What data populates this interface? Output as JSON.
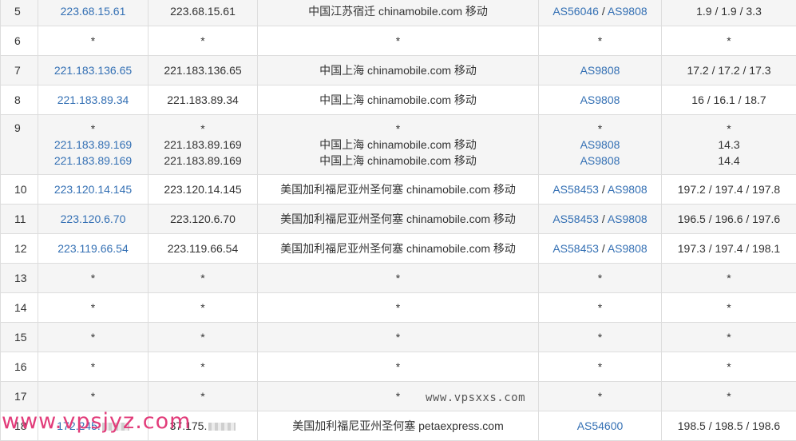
{
  "rows": [
    {
      "hop": "5",
      "ip": "223.68.15.61",
      "host": "223.68.15.61",
      "loc": "中国江苏宿迁 chinamobile.com 移动",
      "asn": [
        "AS56046",
        "AS9808"
      ],
      "time": "1.9 / 1.9 / 3.3"
    },
    {
      "hop": "6",
      "ip": "*",
      "host": "*",
      "loc": "*",
      "asn": [
        "*"
      ],
      "time": "*"
    },
    {
      "hop": "7",
      "ip": "221.183.136.65",
      "host": "221.183.136.65",
      "loc": "中国上海 chinamobile.com 移动",
      "asn": [
        "AS9808"
      ],
      "time": "17.2 / 17.2 / 17.3"
    },
    {
      "hop": "8",
      "ip": "221.183.89.34",
      "host": "221.183.89.34",
      "loc": "中国上海 chinamobile.com 移动",
      "asn": [
        "AS9808"
      ],
      "time": "16 / 16.1 / 18.7"
    },
    {
      "hop": "9",
      "multi": [
        {
          "ip": "*",
          "host": "*",
          "loc": "*",
          "asn": [
            "*"
          ],
          "time": "*"
        },
        {
          "ip": "221.183.89.169",
          "host": "221.183.89.169",
          "loc": "中国上海 chinamobile.com 移动",
          "asn": [
            "AS9808"
          ],
          "time": "14.3"
        },
        {
          "ip": "221.183.89.169",
          "host": "221.183.89.169",
          "loc": "中国上海 chinamobile.com 移动",
          "asn": [
            "AS9808"
          ],
          "time": "14.4"
        }
      ]
    },
    {
      "hop": "10",
      "ip": "223.120.14.145",
      "host": "223.120.14.145",
      "loc": "美国加利福尼亚州圣何塞 chinamobile.com 移动",
      "asn": [
        "AS58453",
        "AS9808"
      ],
      "time": "197.2 / 197.4 / 197.8"
    },
    {
      "hop": "11",
      "ip": "223.120.6.70",
      "host": "223.120.6.70",
      "loc": "美国加利福尼亚州圣何塞 chinamobile.com 移动",
      "asn": [
        "AS58453",
        "AS9808"
      ],
      "time": "196.5 / 196.6 / 197.6"
    },
    {
      "hop": "12",
      "ip": "223.119.66.54",
      "host": "223.119.66.54",
      "loc": "美国加利福尼亚州圣何塞 chinamobile.com 移动",
      "asn": [
        "AS58453",
        "AS9808"
      ],
      "time": "197.3 / 197.4 / 198.1"
    },
    {
      "hop": "13",
      "ip": "*",
      "host": "*",
      "loc": "*",
      "asn": [
        "*"
      ],
      "time": "*"
    },
    {
      "hop": "14",
      "ip": "*",
      "host": "*",
      "loc": "*",
      "asn": [
        "*"
      ],
      "time": "*"
    },
    {
      "hop": "15",
      "ip": "*",
      "host": "*",
      "loc": "*",
      "asn": [
        "*"
      ],
      "time": "*"
    },
    {
      "hop": "16",
      "ip": "*",
      "host": "*",
      "loc": "*",
      "asn": [
        "*"
      ],
      "time": "*"
    },
    {
      "hop": "17",
      "ip": "*",
      "host": "*",
      "loc": "*",
      "asn": [
        "*"
      ],
      "time": "*"
    },
    {
      "hop": "18",
      "ip": "172.245.",
      "host": "37.175.",
      "loc": "美国加利福尼亚州圣何塞 petaexpress.com",
      "asn": [
        "AS54600"
      ],
      "time": "198.5 / 198.5 / 198.6",
      "masked": true
    }
  ],
  "watermarks": {
    "site1": "www.vpsxxs.com",
    "site2": "www.vpsjyz.com"
  }
}
